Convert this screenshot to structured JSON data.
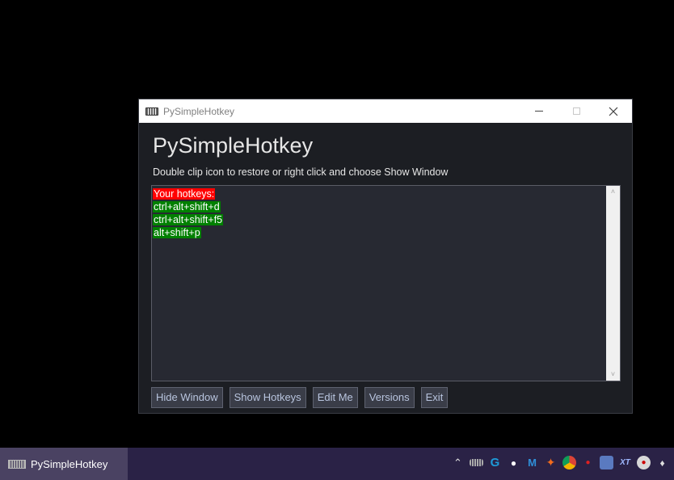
{
  "window": {
    "title": "PySimpleHotkey",
    "heading": "PySimpleHotkey",
    "subtext": "Double clip icon to restore or right click and choose Show Window",
    "output_lines": [
      {
        "text": "Your hotkeys:",
        "highlight": "#ff0000"
      },
      {
        "text": "ctrl+alt+shift+d",
        "highlight": "#008000"
      },
      {
        "text": "ctrl+alt+shift+f5",
        "highlight": "#008000"
      },
      {
        "text": "alt+shift+p",
        "highlight": "#008000"
      }
    ],
    "buttons": {
      "hide": "Hide Window",
      "show": "Show Hotkeys",
      "edit": "Edit Me",
      "versions": "Versions",
      "exit": "Exit"
    }
  },
  "taskbar": {
    "active_app_label": "PySimpleHotkey",
    "tray_icons": [
      "chevron-up-icon",
      "keyboard-icon",
      "logitech-g-icon",
      "discord-icon",
      "malwarebytes-icon",
      "avast-icon",
      "chrome-icon",
      "record-icon",
      "network-icon",
      "xtreme-icon",
      "nvidia-icon",
      "dropbox-icon"
    ]
  },
  "colors": {
    "window_bg": "#1c1e23",
    "button_bg": "#3a3d48",
    "button_text": "#b8c4de",
    "taskbar_bg": "#2a2246"
  }
}
